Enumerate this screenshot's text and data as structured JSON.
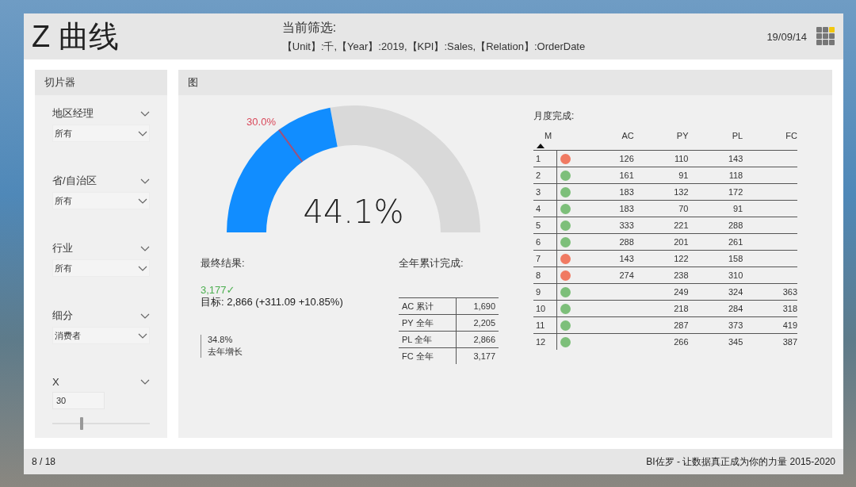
{
  "header": {
    "title": "Z 曲线",
    "filter_label": "当前筛选:",
    "filter_value": "【Unit】:千,【Year】:2019,【KPI】:Sales,【Relation】:OrderDate",
    "date": "19/09/14"
  },
  "slicer_panel": {
    "title": "切片器",
    "slicers": [
      {
        "kind": "dropdown",
        "label": "地区经理",
        "value": "所有"
      },
      {
        "kind": "dropdown",
        "label": "省/自治区",
        "value": "所有"
      },
      {
        "kind": "dropdown",
        "label": "行业",
        "value": "所有"
      },
      {
        "kind": "dropdown",
        "label": "细分",
        "value": "消费者"
      },
      {
        "kind": "slider",
        "label": "X",
        "value": "30",
        "level": 0.3
      }
    ]
  },
  "chart_panel": {
    "title": "图",
    "gauge": {
      "level": 0.441,
      "value_label": "44.1%",
      "target": {
        "label": "30.0%",
        "level": 0.3
      }
    },
    "final_result": {
      "title": "最终结果:",
      "value": "3,177✓",
      "target_line": "目标: 2,866 (+311.09 +10.85%)",
      "growth_value": "34.8%",
      "growth_label": "去年增长"
    },
    "annual": {
      "title": "全年累计完成:",
      "rows": [
        {
          "label": "AC 累计",
          "value": "1,690"
        },
        {
          "label": "PY 全年",
          "value": "2,205"
        },
        {
          "label": "PL 全年",
          "value": "2,866"
        },
        {
          "label": "FC 全年",
          "value": "3,177"
        }
      ]
    },
    "monthly": {
      "title": "月度完成:",
      "columns": [
        "M",
        "AC",
        "PY",
        "PL",
        "FC"
      ],
      "rows": [
        {
          "m": "1",
          "color": "#f07a62",
          "ac": "126",
          "py": "110",
          "pl": "143"
        },
        {
          "m": "2",
          "color": "#7dbf7a",
          "ac": "161",
          "py": "91",
          "pl": "118"
        },
        {
          "m": "3",
          "color": "#7dbf7a",
          "ac": "183",
          "py": "132",
          "pl": "172"
        },
        {
          "m": "4",
          "color": "#7dbf7a",
          "ac": "183",
          "py": "70",
          "pl": "91"
        },
        {
          "m": "5",
          "color": "#7dbf7a",
          "ac": "333",
          "py": "221",
          "pl": "288"
        },
        {
          "m": "6",
          "color": "#7dbf7a",
          "ac": "288",
          "py": "201",
          "pl": "261"
        },
        {
          "m": "7",
          "color": "#f07a62",
          "ac": "143",
          "py": "122",
          "pl": "158"
        },
        {
          "m": "8",
          "color": "#f07a62",
          "ac": "274",
          "py": "238",
          "pl": "310"
        },
        {
          "m": "9",
          "color": "#7dbf7a",
          "py": "249",
          "pl": "324",
          "fc": "363"
        },
        {
          "m": "10",
          "color": "#7dbf7a",
          "py": "218",
          "pl": "284",
          "fc": "318"
        },
        {
          "m": "11",
          "color": "#7dbf7a",
          "py": "287",
          "pl": "373",
          "fc": "419"
        },
        {
          "m": "12",
          "color": "#7dbf7a",
          "py": "266",
          "pl": "345",
          "fc": "387"
        }
      ]
    }
  },
  "footer": {
    "page": "8 / 18",
    "credit": "BI佐罗 - 让数据真正成为你的力量 2015-2020"
  }
}
